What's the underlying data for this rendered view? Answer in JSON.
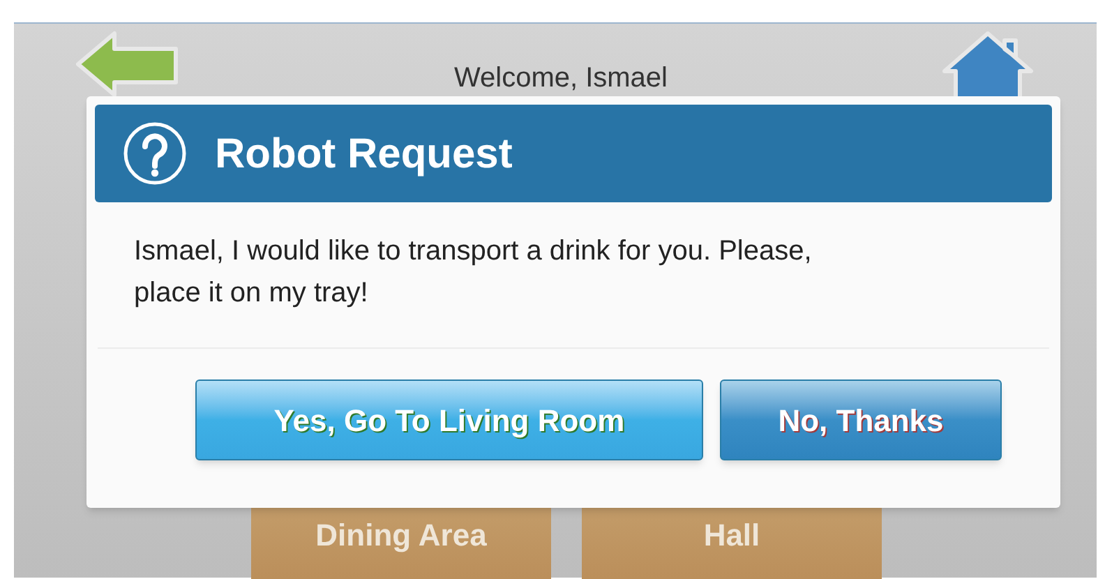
{
  "header": {
    "title": "Welcome, Ismael"
  },
  "rooms": [
    {
      "label": "Dining Area"
    },
    {
      "label": "Hall"
    }
  ],
  "dialog": {
    "title": "Robot Request",
    "message": "Ismael, I would like to transport a drink for you. Please, place it on my tray!",
    "buttons": [
      {
        "label": "Yes, Go To Living Room",
        "kind": "primary"
      },
      {
        "label": "No, Thanks",
        "kind": "secondary"
      }
    ]
  }
}
